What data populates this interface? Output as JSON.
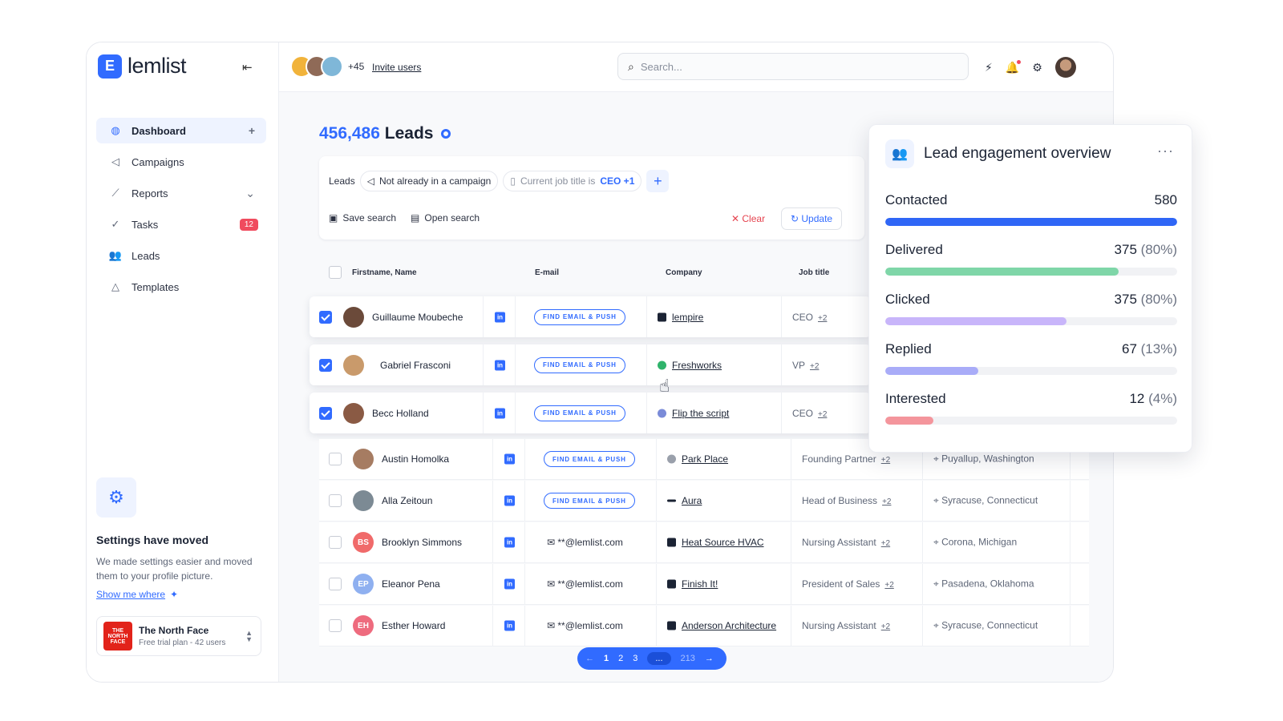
{
  "brand": {
    "name": "lemlist",
    "logo_letter": "E"
  },
  "sidebar": {
    "items": [
      {
        "label": "Dashboard",
        "icon": "dashboard-icon"
      },
      {
        "label": "Campaigns",
        "icon": "megaphone-icon"
      },
      {
        "label": "Reports",
        "icon": "chart-icon"
      },
      {
        "label": "Tasks",
        "icon": "check-circle-icon",
        "badge": "12"
      },
      {
        "label": "Leads",
        "icon": "users-icon"
      },
      {
        "label": "Templates",
        "icon": "shapes-icon"
      }
    ],
    "settings": {
      "title": "Settings have moved",
      "body": "We made settings easier and moved them to your profile picture.",
      "link": "Show me where"
    },
    "workspace": {
      "name": "The North Face",
      "plan": "Free trial plan - 42 users",
      "logo_text": "THE NORTH FACE"
    }
  },
  "topbar": {
    "extra_users": "+45",
    "invite": "Invite users",
    "search_placeholder": "Search..."
  },
  "leads": {
    "count": "456,486",
    "label": "Leads",
    "filters": {
      "leads_label": "Leads",
      "chip1": "Not already in a campaign",
      "chip2_prefix": "Current job title is",
      "chip2_value": "CEO +1",
      "save": "Save search",
      "open": "Open search",
      "clear": "Clear",
      "update": "Update"
    },
    "columns": [
      "Firstname, Name",
      "E-mail",
      "Company",
      "Job title"
    ],
    "find_label": "FIND EMAIL & PUSH",
    "linkedin": "in",
    "rows": [
      {
        "name": "Guillaume Moubeche",
        "company": "lempire",
        "job": "CEO",
        "more": "+2"
      },
      {
        "name": "Gabriel Frasconi",
        "company": "Freshworks",
        "job": "VP",
        "more": "+2"
      },
      {
        "name": "Becc Holland",
        "company": "Flip the script",
        "job": "CEO",
        "more": "+2"
      },
      {
        "name": "Austin Homolka",
        "company": "Park Place",
        "job": "Founding Partner",
        "more": "+2",
        "location": "Puyallup, Washington"
      },
      {
        "name": "Alla Zeitoun",
        "company": "Aura",
        "job": "Head of Business",
        "more": "+2",
        "location": "Syracuse, Connecticut"
      },
      {
        "name": "Brooklyn Simmons",
        "initials": "BS",
        "email": "**@lemlist.com",
        "company": "Heat Source HVAC",
        "job": "Nursing Assistant",
        "more": "+2",
        "location": "Corona, Michigan"
      },
      {
        "name": "Eleanor Pena",
        "initials": "EP",
        "email": "**@lemlist.com",
        "company": "Finish It!",
        "job": "President of Sales",
        "more": "+2",
        "location": "Pasadena, Oklahoma"
      },
      {
        "name": "Esther Howard",
        "initials": "EH",
        "email": "**@lemlist.com",
        "company": "Anderson Architecture",
        "job": "Nursing Assistant",
        "more": "+2",
        "location": "Syracuse, Connecticut"
      }
    ],
    "pager": {
      "prev": "←",
      "p1": "1",
      "p2": "2",
      "p3": "3",
      "ellipsis": "...",
      "last": "213",
      "next": "→"
    }
  },
  "engagement": {
    "title": "Lead engagement overview",
    "metrics": [
      {
        "label": "Contacted",
        "value": "580",
        "pct": "",
        "fraction": 1.0,
        "color": "#2f66f6"
      },
      {
        "label": "Delivered",
        "value": "375",
        "pct": "(80%)",
        "fraction": 0.8,
        "color": "#7fd6a8"
      },
      {
        "label": "Clicked",
        "value": "375",
        "pct": "(80%)",
        "fraction": 0.62,
        "color": "#c8b5fa"
      },
      {
        "label": "Replied",
        "value": "67",
        "pct": "(13%)",
        "fraction": 0.32,
        "color": "#a9acf8"
      },
      {
        "label": "Interested",
        "value": "12",
        "pct": "(4%)",
        "fraction": 0.165,
        "color": "#f4959c"
      }
    ]
  }
}
